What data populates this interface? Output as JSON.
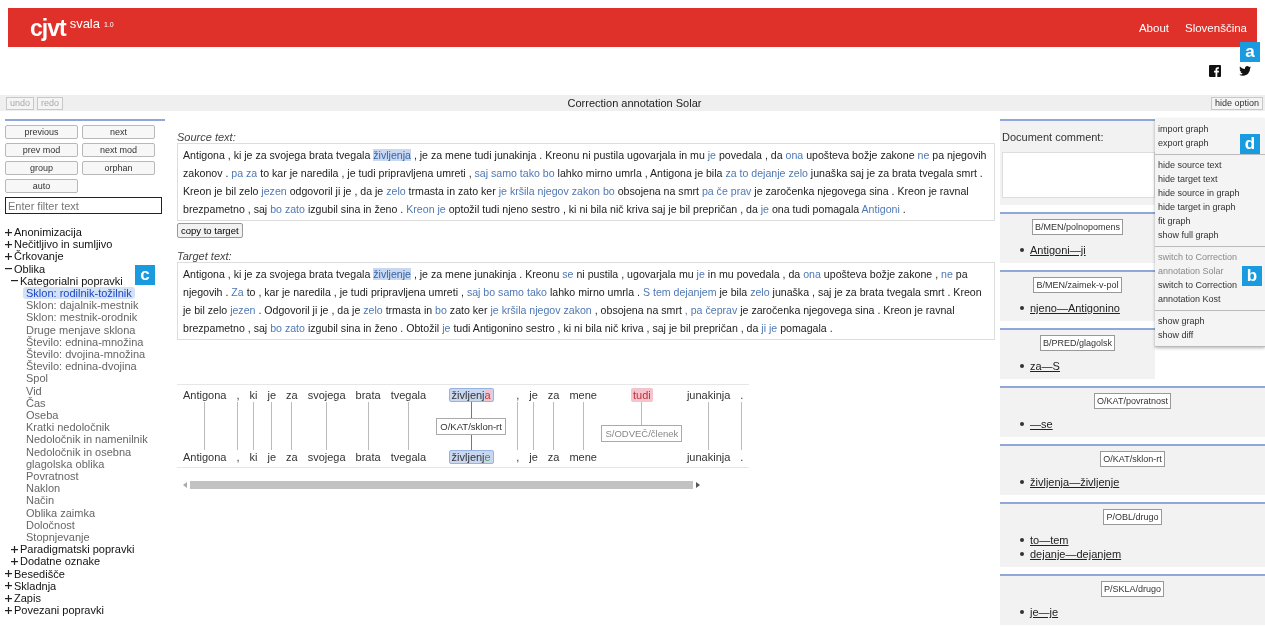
{
  "header": {
    "logo": "cjvt",
    "app": "svala",
    "version": "1.0",
    "nav": [
      "About",
      "Slovenščina"
    ]
  },
  "social": [
    {
      "kind": "facebook"
    },
    {
      "kind": "twitter"
    }
  ],
  "toolbar": {
    "buttons": [
      {
        "label": "undo",
        "disabled": true
      },
      {
        "label": "redo",
        "disabled": true
      }
    ],
    "title": "Correction annotation Solar",
    "toggle": "hide option"
  },
  "sidebar": {
    "buttons": [
      "previous",
      "next",
      "prev mod",
      "next mod",
      "group",
      "orphan",
      "auto"
    ],
    "filter": {
      "placeholder": "Enter filter text"
    },
    "tree": [
      {
        "kind": "group",
        "label": "Anonimizacija",
        "expanded": false
      },
      {
        "kind": "group",
        "label": "Nečitljivo in sumljivo",
        "expanded": false
      },
      {
        "kind": "group",
        "label": "Črkovanje",
        "expanded": false
      },
      {
        "kind": "group",
        "label": "Oblika",
        "expanded": true,
        "children": [
          {
            "kind": "group",
            "label": "Kategorialni popravki",
            "expanded": true,
            "children": [
              {
                "kind": "leaf",
                "label": "Sklon: rodilnik-tožilnik",
                "selected": true
              },
              {
                "kind": "leaf",
                "label": "Sklon: dajalnik-mestnik",
                "selected": false
              },
              {
                "kind": "leaf",
                "label": "Sklon: mestnik-orodnik",
                "selected": false
              },
              {
                "kind": "leaf",
                "label": "Druge menjave sklona",
                "selected": false
              },
              {
                "kind": "leaf",
                "label": "Število: ednina-množina",
                "selected": false
              },
              {
                "kind": "leaf",
                "label": "Število: dvojina-množina",
                "selected": false
              },
              {
                "kind": "leaf",
                "label": "Število: ednina-dvojina",
                "selected": false
              },
              {
                "kind": "leaf",
                "label": "Spol",
                "selected": false
              },
              {
                "kind": "leaf",
                "label": "Vid",
                "selected": false
              },
              {
                "kind": "leaf",
                "label": "Čas",
                "selected": false
              },
              {
                "kind": "leaf",
                "label": "Oseba",
                "selected": false
              },
              {
                "kind": "leaf",
                "label": "Kratki nedoločnik",
                "selected": false
              },
              {
                "kind": "leaf",
                "label": "Nedoločnik in namenilnik",
                "selected": false
              },
              {
                "kind": "leaf",
                "label": "Nedoločnik in osebna glagolska oblika",
                "selected": false
              },
              {
                "kind": "leaf",
                "label": "Povratnost",
                "selected": false
              },
              {
                "kind": "leaf",
                "label": "Naklon",
                "selected": false
              },
              {
                "kind": "leaf",
                "label": "Način",
                "selected": false
              },
              {
                "kind": "leaf",
                "label": "Oblika zaimka",
                "selected": false
              },
              {
                "kind": "leaf",
                "label": "Določnost",
                "selected": false
              },
              {
                "kind": "leaf",
                "label": "Stopnjevanje",
                "selected": false
              }
            ]
          },
          {
            "kind": "group",
            "label": "Paradigmatski popravki",
            "expanded": false
          },
          {
            "kind": "group",
            "label": "Dodatne oznake",
            "expanded": false
          }
        ]
      },
      {
        "kind": "group",
        "label": "Besedišče",
        "expanded": false
      },
      {
        "kind": "group",
        "label": "Skladnja",
        "expanded": false
      },
      {
        "kind": "group",
        "label": "Zapis",
        "expanded": false
      },
      {
        "kind": "group",
        "label": "Povezani popravki",
        "expanded": false
      }
    ]
  },
  "source": {
    "label": "Source text:",
    "copy_button": "copy to target",
    "segments": [
      {
        "kind": "plain",
        "text": "Antigona , ki je za svojega brata tvegala"
      },
      {
        "kind": "selected",
        "text": "življenja"
      },
      {
        "kind": "plain",
        "text": ", je za mene tudi junakinja . Kreonu ni pustila ugovarjala in mu"
      },
      {
        "kind": "changed",
        "text": "je"
      },
      {
        "kind": "plain",
        "text": "povedala , da"
      },
      {
        "kind": "changed",
        "text": "ona"
      },
      {
        "kind": "plain",
        "text": "upošteva božje zakone"
      },
      {
        "kind": "changed",
        "text": "ne"
      },
      {
        "kind": "plain",
        "text": "pa njegovih zakonov ."
      },
      {
        "kind": "changed",
        "text": "pa za"
      },
      {
        "kind": "plain",
        "text": "to kar je naredila , je tudi pripravljena umreti ,"
      },
      {
        "kind": "changed",
        "text": "saj samo tako bo"
      },
      {
        "kind": "plain",
        "text": "lahko mirno umrla , Antigona je bila"
      },
      {
        "kind": "changed",
        "text": "za to dejanje zelo"
      },
      {
        "kind": "plain",
        "text": "junaška saj je za brata tvegala smrt . Kreon je bil zelo"
      },
      {
        "kind": "changed",
        "text": "jezen"
      },
      {
        "kind": "plain",
        "text": "odgovoril ji je , da je"
      },
      {
        "kind": "changed",
        "text": "zelo"
      },
      {
        "kind": "plain",
        "text": "trmasta in zato ker"
      },
      {
        "kind": "changed",
        "text": "je kršila njegov zakon bo"
      },
      {
        "kind": "plain",
        "text": "obsojena na smrt"
      },
      {
        "kind": "changed",
        "text": "pa če prav"
      },
      {
        "kind": "plain",
        "text": "je zaročenka njegovega sina . Kreon je ravnal brezpametno , saj"
      },
      {
        "kind": "changed",
        "text": "bo zato"
      },
      {
        "kind": "plain",
        "text": "izgubil sina in ženo ."
      },
      {
        "kind": "changed",
        "text": "Kreon je"
      },
      {
        "kind": "plain",
        "text": "optožil tudi njeno sestro , ki ni bila nič kriva saj je bil prepričan , da"
      },
      {
        "kind": "changed",
        "text": "je"
      },
      {
        "kind": "plain",
        "text": "ona tudi pomagala"
      },
      {
        "kind": "changed",
        "text": "Antigoni"
      },
      {
        "kind": "plain",
        "text": "."
      }
    ]
  },
  "target": {
    "label": "Target text:",
    "segments": [
      {
        "kind": "plain",
        "text": "Antigona , ki je za svojega brata tvegala"
      },
      {
        "kind": "selected",
        "text": "življenje"
      },
      {
        "kind": "plain",
        "text": ", je za mene junakinja . Kreonu"
      },
      {
        "kind": "changed",
        "text": "se"
      },
      {
        "kind": "plain",
        "text": "ni pustila , ugovarjala mu"
      },
      {
        "kind": "changed",
        "text": "je"
      },
      {
        "kind": "plain",
        "text": "in mu povedala , da"
      },
      {
        "kind": "changed",
        "text": "ona"
      },
      {
        "kind": "plain",
        "text": "upošteva božje zakone ,"
      },
      {
        "kind": "changed",
        "text": "ne"
      },
      {
        "kind": "plain",
        "text": "pa njegovih ."
      },
      {
        "kind": "changed",
        "text": "Za"
      },
      {
        "kind": "plain",
        "text": "to , kar je naredila , je tudi pripravljena umreti ,"
      },
      {
        "kind": "changed",
        "text": "saj bo samo tako"
      },
      {
        "kind": "plain",
        "text": "lahko mirno umrla ."
      },
      {
        "kind": "changed",
        "text": "S tem dejanjem"
      },
      {
        "kind": "plain",
        "text": "je bila"
      },
      {
        "kind": "changed",
        "text": "zelo"
      },
      {
        "kind": "plain",
        "text": "junaška , saj je za brata tvegala smrt . Kreon je bil zelo"
      },
      {
        "kind": "changed",
        "text": "jezen"
      },
      {
        "kind": "plain",
        "text": ". Odgovoril ji je , da je"
      },
      {
        "kind": "changed",
        "text": "zelo"
      },
      {
        "kind": "plain",
        "text": "trmasta in"
      },
      {
        "kind": "changed",
        "text": "bo"
      },
      {
        "kind": "plain",
        "text": "zato ker"
      },
      {
        "kind": "changed",
        "text": "je kršila njegov zakon"
      },
      {
        "kind": "plain",
        "text": ", obsojena na smrt"
      },
      {
        "kind": "changed",
        "text": ", pa čeprav"
      },
      {
        "kind": "plain",
        "text": "je zaročenka njegovega sina . Kreon je ravnal brezpametno , saj"
      },
      {
        "kind": "changed",
        "text": "bo zato"
      },
      {
        "kind": "plain",
        "text": "izgubil sina in ženo . Obtožil"
      },
      {
        "kind": "changed",
        "text": "je"
      },
      {
        "kind": "plain",
        "text": "tudi Antigonino sestro , ki ni bila nič kriva , saj je bil prepričan , da"
      },
      {
        "kind": "changed",
        "text": "ji je"
      },
      {
        "kind": "plain",
        "text": "pomagala ."
      }
    ]
  },
  "graph": {
    "columns": [
      {
        "source": "Antigona",
        "target": "Antigona",
        "selected": false
      },
      {
        "source": ",",
        "target": ",",
        "selected": false
      },
      {
        "source": "ki",
        "target": "ki",
        "selected": false
      },
      {
        "source": "je",
        "target": "je",
        "selected": false
      },
      {
        "source": "za",
        "target": "za",
        "selected": false
      },
      {
        "source": "svojega",
        "target": "svojega",
        "selected": false
      },
      {
        "source": "brata",
        "target": "brata",
        "selected": false
      },
      {
        "source": "tvegala",
        "target": "tvegala",
        "selected": false
      },
      {
        "source": "življenj",
        "source_diff": "a",
        "target": "življenj",
        "target_diff": "e",
        "label": "O/KAT/sklon-rt",
        "selected": true
      },
      {
        "source": ",",
        "target": ",",
        "selected": false
      },
      {
        "source": "je",
        "target": "je",
        "selected": false
      },
      {
        "source": "za",
        "target": "za",
        "selected": false
      },
      {
        "source": "mene",
        "target": "mene",
        "selected": false
      },
      {
        "source": "tudi",
        "source_deleted": true,
        "label": "S/ODVEČ/členek",
        "selected": false
      },
      {
        "source": "junakinja",
        "target": "junakinja",
        "selected": false
      },
      {
        "source": ".",
        "target": ".",
        "selected": false
      }
    ]
  },
  "comment": {
    "label": "Document comment:"
  },
  "menu": [
    [
      {
        "label": "import graph",
        "disabled": false
      },
      {
        "label": "export graph",
        "disabled": false
      }
    ],
    [
      {
        "label": "hide source text",
        "disabled": false
      },
      {
        "label": "hide target text",
        "disabled": false
      },
      {
        "label": "hide source in graph",
        "disabled": false
      },
      {
        "label": "hide target in graph",
        "disabled": false
      },
      {
        "label": "fit graph",
        "disabled": false
      },
      {
        "label": "show full graph",
        "disabled": false
      }
    ],
    [
      {
        "label": "switch to Correction annotation Solar",
        "disabled": true
      },
      {
        "label": "switch to Correction annotation Kost",
        "disabled": false
      }
    ],
    [
      {
        "label": "show graph",
        "disabled": false
      },
      {
        "label": "show diff",
        "disabled": false
      }
    ]
  ],
  "annotations": [
    {
      "tag": "B/MEN/polnopomens",
      "links": [
        "Antigoni—ji"
      ]
    },
    {
      "tag": "B/MEN/zaimek-v-pol",
      "links": [
        "njeno—Antigonino"
      ]
    },
    {
      "tag": "B/PRED/glagolsk",
      "links": [
        "za—S"
      ]
    },
    {
      "tag": "O/KAT/povratnost",
      "links": [
        "—se"
      ]
    },
    {
      "tag": "O/KAT/sklon-rt",
      "links": [
        "življenja—življenje"
      ]
    },
    {
      "tag": "P/OBL/drugo",
      "links": [
        "to—tem",
        "dejanje—dejanjem"
      ]
    },
    {
      "tag": "P/SKLA/drugo",
      "links": [
        "je—je"
      ]
    }
  ],
  "callouts": [
    "a",
    "d",
    "c",
    "b"
  ]
}
